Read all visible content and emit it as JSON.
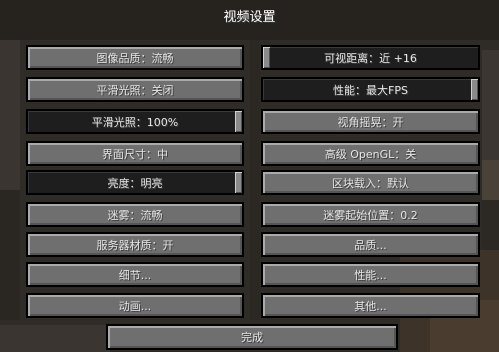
{
  "title": "视频设置",
  "left_column": [
    {
      "label": "图像品质：流畅",
      "type": "button"
    },
    {
      "label": "平滑光照：关闭",
      "type": "button"
    },
    {
      "label": "平滑光照：100%",
      "type": "slider",
      "level": 1.0
    },
    {
      "label": "界面尺寸：中",
      "type": "button"
    },
    {
      "label": "亮度：明亮",
      "type": "slider",
      "level": 1.0
    },
    {
      "label": "迷雾：流畅",
      "type": "button"
    },
    {
      "label": "服务器材质：开",
      "type": "button"
    },
    {
      "label": "细节...",
      "type": "button"
    },
    {
      "label": "动画...",
      "type": "button"
    }
  ],
  "right_column": [
    {
      "label": "可视距离：近 +16",
      "type": "slider",
      "level": 0.0
    },
    {
      "label": "性能：最大FPS",
      "type": "slider",
      "level": 1.0
    },
    {
      "label": "视角摇晃：开",
      "type": "button"
    },
    {
      "label": "高级 OpenGL：关",
      "type": "button"
    },
    {
      "label": "区块载入：默认",
      "type": "button"
    },
    {
      "label": "迷雾起始位置：0.2",
      "type": "button"
    },
    {
      "label": "品质...",
      "type": "button"
    },
    {
      "label": "性能...",
      "type": "button"
    },
    {
      "label": "其他...",
      "type": "button"
    }
  ],
  "done_label": "完成",
  "colors": {
    "button_face": "#6f6f6f",
    "slider_track": "#1e1e1e",
    "text": "#e6e6e6"
  }
}
